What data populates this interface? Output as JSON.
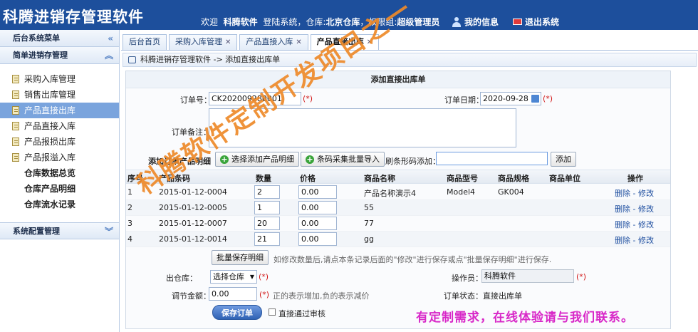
{
  "header": {
    "brand": "科腾进销存管理软件",
    "welcome_prefix": "欢迎",
    "user": "科腾软件",
    "login_text": "登陆系统，仓库:",
    "warehouse": "北京仓库",
    "perm_text": "，权限组:",
    "perm_group": "超级管理员",
    "my_info": "我的信息",
    "logout": "退出系统"
  },
  "sidebar": {
    "menu_title": "后台系统菜单",
    "group_title": "简单进销存管理",
    "items": [
      {
        "label": "采购入库管理",
        "active": false,
        "bold": false
      },
      {
        "label": "销售出库管理",
        "active": false,
        "bold": false
      },
      {
        "label": "产品直接出库",
        "active": true,
        "bold": false
      },
      {
        "label": "产品直接入库",
        "active": false,
        "bold": false
      },
      {
        "label": "产品报损出库",
        "active": false,
        "bold": false
      },
      {
        "label": "产品报溢入库",
        "active": false,
        "bold": false
      },
      {
        "label": "仓库数据总览",
        "active": false,
        "bold": true
      },
      {
        "label": "仓库产品明细",
        "active": false,
        "bold": true
      },
      {
        "label": "仓库流水记录",
        "active": false,
        "bold": true
      }
    ],
    "sys_group": "系统配置管理"
  },
  "tabs": [
    {
      "label": "后台首页",
      "closable": false
    },
    {
      "label": "采购入库管理",
      "closable": true
    },
    {
      "label": "产品直接入库",
      "closable": true
    },
    {
      "label": "产品直接出库",
      "closable": true
    }
  ],
  "breadcrumb": "科腾进销存管理软件 -> 添加直接出库单",
  "form": {
    "title": "添加直接出库单",
    "order_no_label": "订单号：",
    "order_no": "CK202009280001",
    "order_date_label": "订单日期：",
    "order_date": "2020-09-28",
    "remark_label": "订单备注：",
    "req_mark": "(*)",
    "detail_label": "添加订单产品明细",
    "select_btn": "选择添加产品明细",
    "batch_import_btn": "条码采集批量导入",
    "barcode_label": "刷条形码添加：",
    "add_btn": "添加",
    "columns": [
      "序号",
      "产品条码",
      "数量",
      "价格",
      "商品名称",
      "商品型号",
      "商品规格",
      "商品单位",
      "操作"
    ],
    "rows": [
      {
        "no": "1",
        "barcode": "2015-01-12-0004",
        "qty": "2",
        "price": "0.00",
        "name": "产品名称演示4",
        "model": "Model4",
        "spec": "GK004",
        "unit": ""
      },
      {
        "no": "2",
        "barcode": "2015-01-12-0005",
        "qty": "1",
        "price": "0.00",
        "name": "55",
        "model": "",
        "spec": "",
        "unit": ""
      },
      {
        "no": "3",
        "barcode": "2015-01-12-0007",
        "qty": "20",
        "price": "0.00",
        "name": "77",
        "model": "",
        "spec": "",
        "unit": ""
      },
      {
        "no": "4",
        "barcode": "2015-01-12-0014",
        "qty": "21",
        "price": "0.00",
        "name": "gg",
        "model": "",
        "spec": "",
        "unit": ""
      }
    ],
    "delete_link": "删除",
    "link_sep": "-",
    "edit_link": "修改",
    "batch_save_btn": "批量保存明细",
    "batch_save_hint": "如修改数量后,请点本条记录后面的\"修改\"进行保存或点\"批量保存明细\"进行保存.",
    "out_wh_label": "出仓库：",
    "out_wh_value": "选择仓库",
    "operator_label": "操作员：",
    "operator_value": "科腾软件",
    "adjust_label": "调节金额：",
    "adjust_value": "0.00",
    "adjust_hint": "正的表示增加,负的表示减价",
    "status_label": "订单状态：",
    "status_value": "直接出库单",
    "save_btn": "保存订单",
    "audit_label": "直接通过审核"
  },
  "watermark": "科腾软件定制开发项目之一",
  "promo": "有定制需求，在线体验请与我们联系。"
}
